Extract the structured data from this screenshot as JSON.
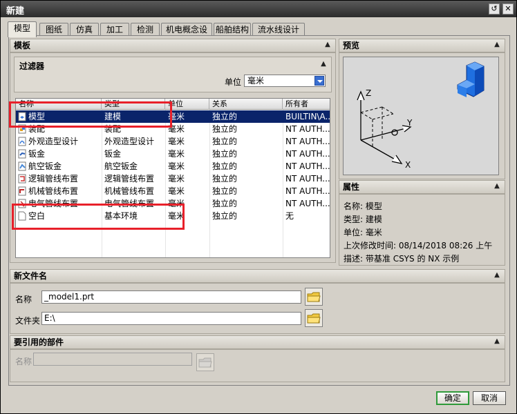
{
  "window": {
    "title": "新建"
  },
  "tabs": [
    "模型",
    "图纸",
    "仿真",
    "加工",
    "检测",
    "机电概念设计",
    "船舶结构",
    "流水线设计器"
  ],
  "template_section": {
    "title": "模板"
  },
  "filter": {
    "title": "过滤器",
    "unit_label": "单位",
    "unit_value": "毫米"
  },
  "table": {
    "columns": [
      "名称",
      "类型",
      "单位",
      "关系",
      "所有者"
    ],
    "rows": [
      {
        "name": "模型",
        "type": "建模",
        "unit": "毫米",
        "relation": "独立的",
        "owner": "BUILTIN\\A...",
        "selected": true,
        "icon": "model-icon"
      },
      {
        "name": "装配",
        "type": "装配",
        "unit": "毫米",
        "relation": "独立的",
        "owner": "NT AUTH...",
        "icon": "assembly-icon"
      },
      {
        "name": "外观造型设计",
        "type": "外观造型设计",
        "unit": "毫米",
        "relation": "独立的",
        "owner": "NT AUTH...",
        "icon": "shape-studio-icon"
      },
      {
        "name": "钣金",
        "type": "钣金",
        "unit": "毫米",
        "relation": "独立的",
        "owner": "NT AUTH...",
        "icon": "sheet-metal-icon"
      },
      {
        "name": "航空钣金",
        "type": "航空钣金",
        "unit": "毫米",
        "relation": "独立的",
        "owner": "NT AUTH...",
        "icon": "aero-sheet-metal-icon"
      },
      {
        "name": "逻辑管线布置",
        "type": "逻辑管线布置",
        "unit": "毫米",
        "relation": "独立的",
        "owner": "NT AUTH...",
        "icon": "logical-routing-icon"
      },
      {
        "name": "机械管线布置",
        "type": "机械管线布置",
        "unit": "毫米",
        "relation": "独立的",
        "owner": "NT AUTH...",
        "icon": "mechanical-routing-icon"
      },
      {
        "name": "电气管线布置",
        "type": "电气管线布置",
        "unit": "毫米",
        "relation": "独立的",
        "owner": "NT AUTH...",
        "icon": "electrical-routing-icon"
      },
      {
        "name": "空白",
        "type": "基本环境",
        "unit": "毫米",
        "relation": "独立的",
        "owner": "无",
        "icon": "blank-file-icon"
      }
    ]
  },
  "preview": {
    "title": "预览",
    "axes": [
      "Z",
      "Y",
      "X"
    ]
  },
  "properties": {
    "title": "属性",
    "items": [
      {
        "label": "名称:",
        "value": "模型"
      },
      {
        "label": "类型:",
        "value": "建模"
      },
      {
        "label": "单位:",
        "value": "毫米"
      },
      {
        "label": "上次修改时间:",
        "value": "08/14/2018 08:26 上午"
      },
      {
        "label": "描述:",
        "value": "带基准 CSYS 的 NX 示例"
      }
    ]
  },
  "new_file": {
    "title": "新文件名",
    "name_label": "名称",
    "name_value": "_model1.prt",
    "folder_label": "文件夹",
    "folder_value": "E:\\"
  },
  "ref_part": {
    "title": "要引用的部件",
    "name_label": "名称",
    "name_value": ""
  },
  "buttons": {
    "ok": "确定",
    "cancel": "取消"
  },
  "colors": {
    "selection": "#0a246a",
    "highlight_box": "#e8202a",
    "ok_border": "#2f9a3a"
  }
}
